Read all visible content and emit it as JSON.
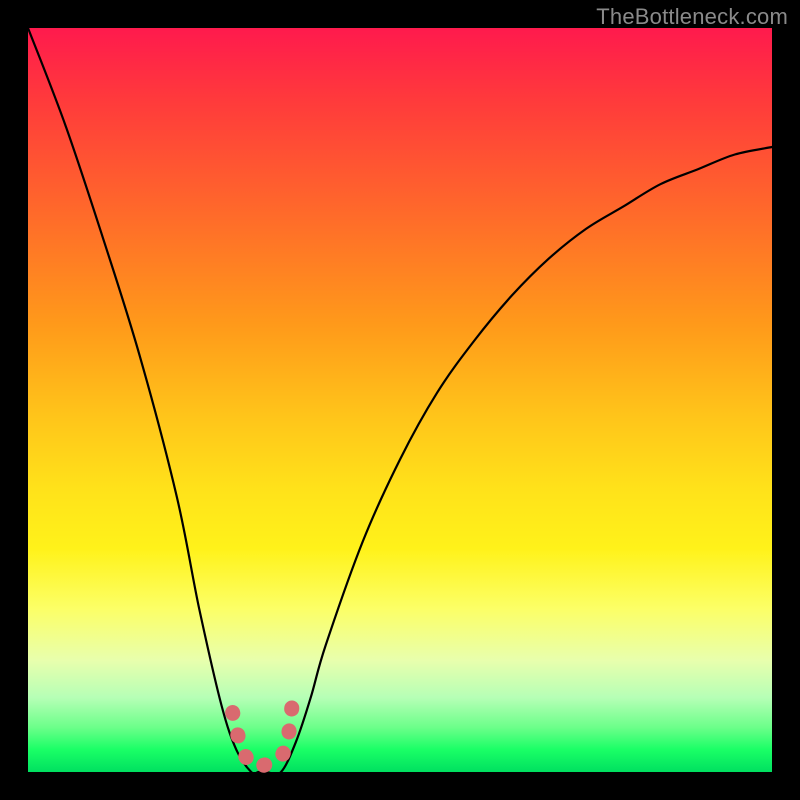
{
  "watermark": "TheBottleneck.com",
  "chart_data": {
    "type": "line",
    "title": "",
    "xlabel": "",
    "ylabel": "",
    "x_range": [
      0,
      100
    ],
    "y_range": [
      0,
      100
    ],
    "series": [
      {
        "name": "bottleneck-curve",
        "x": [
          0,
          5,
          10,
          15,
          20,
          23,
          26,
          28,
          30,
          31,
          32,
          34,
          36,
          38,
          40,
          45,
          50,
          55,
          60,
          65,
          70,
          75,
          80,
          85,
          90,
          95,
          100
        ],
        "y": [
          100,
          87,
          72,
          56,
          37,
          22,
          9,
          3,
          0,
          0,
          0,
          0,
          4,
          10,
          17,
          31,
          42,
          51,
          58,
          64,
          69,
          73,
          76,
          79,
          81,
          83,
          84
        ]
      },
      {
        "name": "no-bottleneck-zone",
        "x": [
          27.5,
          28.5,
          30,
          32,
          34,
          35,
          35.5
        ],
        "y": [
          8,
          4,
          1,
          1,
          2,
          5,
          9
        ]
      }
    ],
    "gradient_stops": [
      {
        "pos": 0.0,
        "color": "#ff1a4d"
      },
      {
        "pos": 0.25,
        "color": "#ff6a2a"
      },
      {
        "pos": 0.5,
        "color": "#ffc41a"
      },
      {
        "pos": 0.75,
        "color": "#fcff66"
      },
      {
        "pos": 0.95,
        "color": "#6cff8a"
      },
      {
        "pos": 1.0,
        "color": "#00e060"
      }
    ],
    "annotations": []
  }
}
